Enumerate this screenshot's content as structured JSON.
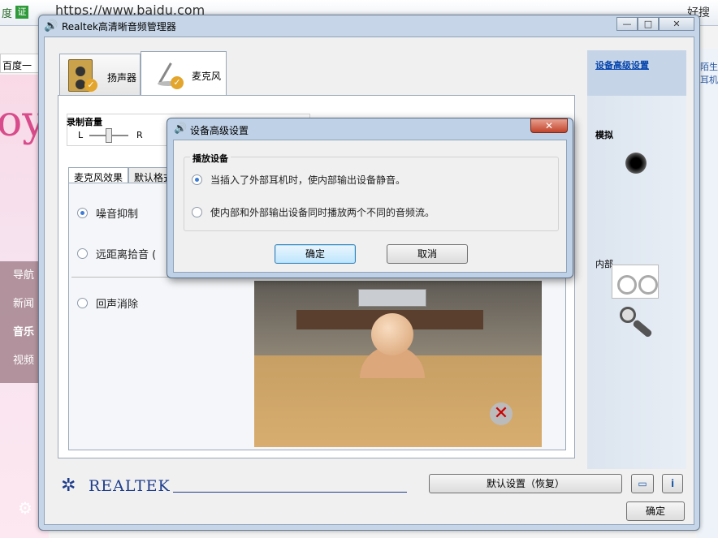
{
  "browser": {
    "tab_text": "度",
    "cert_badge": "证",
    "url": "https://www.baidu.com",
    "right_search": "好搜",
    "baidu_button": "百度一下",
    "nav": [
      "导航",
      "新闻",
      "音乐",
      "视频"
    ],
    "side_text": "陌生\n耳机"
  },
  "window": {
    "title": "Realtek高清晰音频管理器",
    "minimize": "—",
    "maximize": "□",
    "close": "✕"
  },
  "device_tabs": [
    {
      "label": "扬声器"
    },
    {
      "label": "麦克风"
    }
  ],
  "volume": {
    "title": "录制音量",
    "left": "L",
    "right": "R"
  },
  "effect_tabs": [
    "麦克风效果",
    "默认格式"
  ],
  "effects": {
    "noise_suppression": "噪音抑制",
    "far_field": "远距离拾音 (",
    "echo_cancel": "回声消除"
  },
  "side": {
    "advanced_link": "设备高级设置",
    "analog": "模拟",
    "internal": "内部"
  },
  "footer": {
    "brand": "REALTEK",
    "restore_default": "默认设置（恢复）",
    "ok": "确定"
  },
  "dialog": {
    "title": "设备高级设置",
    "close": "✕",
    "group_title": "播放设备",
    "option_1": "当插入了外部耳机时，使内部输出设备静音。",
    "option_2": "使内部和外部输出设备同时播放两个不同的音频流。",
    "selected": 1,
    "ok": "确定",
    "cancel": "取消"
  }
}
